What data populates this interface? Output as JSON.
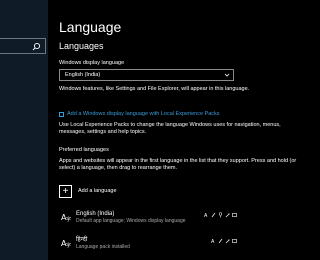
{
  "sidebar": {
    "search_icon": "search-icon"
  },
  "page": {
    "title": "Language",
    "section_title": "Languages",
    "display_label": "Windows display language",
    "display_value": "English (India)",
    "display_desc": "Windows features, like Settings and File Explorer, will appear in this language.",
    "lep_link": "Add a Windows display language with Local Experience Packs",
    "lep_desc": "Use Local Experience Packs to change the language Windows uses for navigation, menus, messages, settings and help topics.",
    "preferred_title": "Preferred languages",
    "preferred_desc": "Apps and websites will appear in the first language in the list that they support. Press and hold (or select) a language, then drag to rearrange them.",
    "add_language": "Add a language",
    "add_glyph": "+"
  },
  "languages": [
    {
      "name": "English (India)",
      "desc": "Default app language; Windows display language",
      "icon": "language-icon"
    },
    {
      "name": "हिन्दी",
      "desc": "Language pack installed",
      "icon": "language-icon"
    }
  ],
  "colors": {
    "accent": "#3a9bd9",
    "background": "#000000",
    "sidebar": "#0f1c27",
    "secondary_text": "#a9a9a9"
  }
}
